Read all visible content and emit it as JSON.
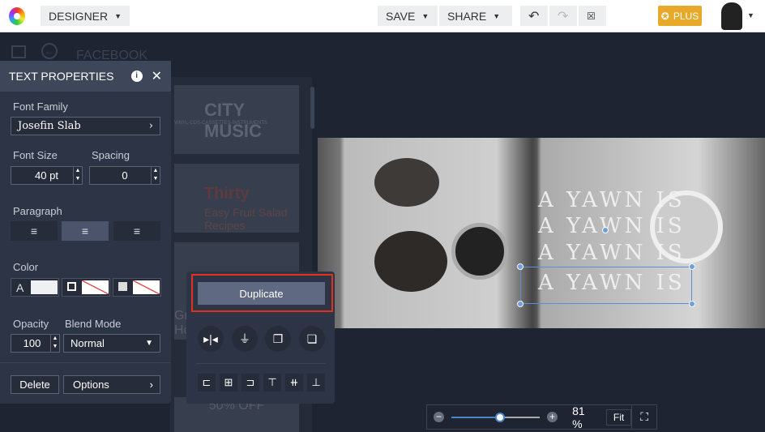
{
  "topbar": {
    "mode": "DESIGNER",
    "save": "SAVE",
    "share": "SHARE",
    "plus": "PLUS"
  },
  "subheader": {
    "title": "FACEBOOK"
  },
  "thumbnails": {
    "t1_title": "CITY MUSIC",
    "t1_sub": "VINYL-CDS-CASSETTES-INSTRUMENTS",
    "t2_title": "Thirty",
    "t2_sub": "Easy Fruit Salad Recipes",
    "t3": "Gr Ho",
    "t4": "50% OFF"
  },
  "canvas": {
    "lines": [
      "A YAWN IS",
      "A YAWN IS",
      "A YAWN IS",
      "A YAWN IS"
    ]
  },
  "panel": {
    "title": "TEXT PROPERTIES",
    "font_family_label": "Font Family",
    "font_family": "Josefin Slab",
    "font_size_label": "Font Size",
    "font_size": "40 pt",
    "spacing_label": "Spacing",
    "spacing": "0",
    "paragraph_label": "Paragraph",
    "color_label": "Color",
    "color_text_glyph": "A",
    "opacity_label": "Opacity",
    "opacity": "100",
    "blend_label": "Blend Mode",
    "blend": "Normal",
    "delete": "Delete",
    "options": "Options"
  },
  "float": {
    "duplicate": "Duplicate"
  },
  "zoom": {
    "percent": "81 %",
    "fit": "Fit",
    "value": 0.55
  }
}
